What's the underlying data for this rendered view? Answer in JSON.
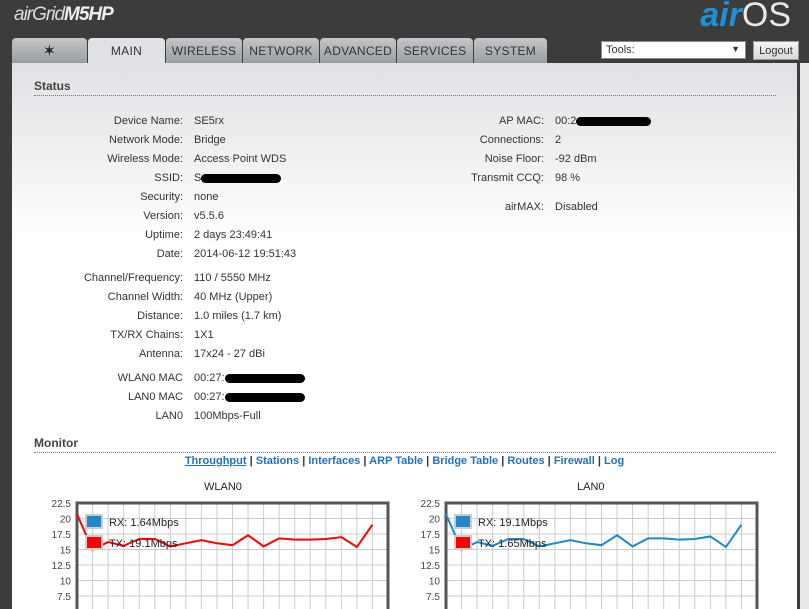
{
  "header": {
    "product_prefix": "air",
    "product_name": "Grid",
    "product_model": "M5HP",
    "brand_air": "air",
    "brand_os": "OS"
  },
  "tabs": [
    "MAIN",
    "WIRELESS",
    "NETWORK",
    "ADVANCED",
    "SERVICES",
    "SYSTEM"
  ],
  "tools": {
    "label": "Tools:",
    "arrow": "▼"
  },
  "logout": "Logout",
  "status": {
    "title": "Status",
    "left": [
      {
        "label": "Device Name:",
        "value": "SE5rx"
      },
      {
        "label": "Network Mode:",
        "value": "Bridge"
      },
      {
        "label": "Wireless Mode:",
        "value": "Access Point WDS"
      },
      {
        "label": "SSID:",
        "value": "S",
        "redacted": true
      },
      {
        "label": "Security:",
        "value": "none"
      },
      {
        "label": "Version:",
        "value": "v5.5.6"
      },
      {
        "label": "Uptime:",
        "value": "2 days 23:49:41"
      },
      {
        "label": "Date:",
        "value": "2014-06-12 19:51:43"
      },
      {
        "label": "Channel/Frequency:",
        "value": "110 / 5550 MHz"
      },
      {
        "label": "Channel Width:",
        "value": "40 MHz (Upper)"
      },
      {
        "label": "Distance:",
        "value": "1.0 miles (1.7 km)"
      },
      {
        "label": "TX/RX Chains:",
        "value": "1X1"
      },
      {
        "label": "Antenna:",
        "value": "17x24 - 27 dBi"
      },
      {
        "label": "WLAN0 MAC",
        "value": "00:27:",
        "redacted": true
      },
      {
        "label": "LAN0 MAC",
        "value": "00:27:",
        "redacted": true
      },
      {
        "label": "LAN0",
        "value": "100Mbps-Full"
      }
    ],
    "right": [
      {
        "label": "AP MAC:",
        "value": "00:2",
        "redacted": true
      },
      {
        "label": "Connections:",
        "value": "2"
      },
      {
        "label": "Noise Floor:",
        "value": "-92 dBm"
      },
      {
        "label": "Transmit CCQ:",
        "value": "98 %"
      },
      {
        "label": "airMAX:",
        "value": "Disabled"
      }
    ]
  },
  "monitor": {
    "title": "Monitor",
    "links": [
      "Throughput",
      "Stations",
      "Interfaces",
      "ARP Table",
      "Bridge Table",
      "Routes",
      "Firewall",
      "Log"
    ],
    "separator": "|"
  },
  "chart_data": [
    {
      "type": "line",
      "title": "WLAN0",
      "yticks": [
        "22.5",
        "20",
        "17.5",
        "15",
        "12.5",
        "10",
        "7.5"
      ],
      "ylim": [
        5,
        22.5
      ],
      "series": [
        {
          "name": "RX",
          "legend": "RX: 1.64Mbps",
          "color": "#1e88c8",
          "values": []
        },
        {
          "name": "TX",
          "legend": "TX: 19.1Mbps",
          "color": "#ff0000",
          "values": [
            20.7,
            15,
            16.2,
            15.6,
            16.7,
            16.7,
            15.5,
            16,
            16.5,
            16,
            15.7,
            17.3,
            15.5,
            16.8,
            16.6,
            16.6,
            16.7,
            17,
            15.4,
            19
          ]
        }
      ]
    },
    {
      "type": "line",
      "title": "LAN0",
      "yticks": [
        "22.5",
        "20",
        "17.5",
        "15",
        "12.5",
        "10",
        "7.5"
      ],
      "ylim": [
        5,
        22.5
      ],
      "series": [
        {
          "name": "RX",
          "legend": "RX: 19.1Mbps",
          "color": "#1e88c8",
          "values": [
            20.7,
            15,
            16.2,
            15.6,
            16.7,
            16.7,
            15.5,
            16,
            16.5,
            16,
            15.7,
            17.3,
            15.5,
            16.8,
            16.8,
            16.6,
            16.7,
            17.1,
            15.4,
            19
          ]
        },
        {
          "name": "TX",
          "legend": "TX: 1.65Mbps",
          "color": "#ff0000",
          "values": []
        }
      ]
    }
  ]
}
